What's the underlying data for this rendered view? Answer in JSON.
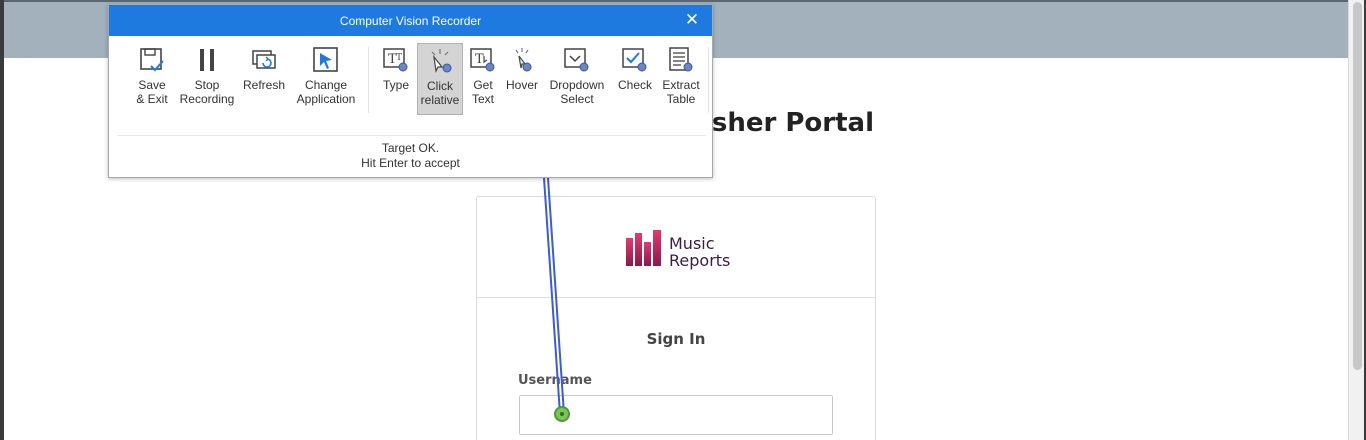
{
  "portal": {
    "title": "blisher Portal",
    "logo_line1": "Music",
    "logo_line2": "Reports",
    "signin_title": "Sign In",
    "username_label": "Username",
    "username_value": ""
  },
  "recorder": {
    "window_title": "Computer Vision Recorder",
    "close_icon": "close-icon",
    "tools": [
      {
        "id": "save-exit",
        "label1": "Save",
        "label2": "& Exit",
        "icon": "save-icon"
      },
      {
        "id": "stop-recording",
        "label1": "Stop",
        "label2": "Recording",
        "icon": "pause-icon"
      },
      {
        "id": "refresh",
        "label1": "Refresh",
        "label2": "",
        "icon": "refresh-icon"
      },
      {
        "id": "change-application",
        "label1": "Change",
        "label2": "Application",
        "icon": "cursor-window-icon"
      },
      {
        "id": "type",
        "label1": "Type",
        "label2": "",
        "icon": "type-icon"
      },
      {
        "id": "click-relative",
        "label1": "Click",
        "label2": "relative",
        "icon": "click-relative-icon",
        "active": true
      },
      {
        "id": "get-text",
        "label1": "Get",
        "label2": "Text",
        "icon": "get-text-icon"
      },
      {
        "id": "hover",
        "label1": "Hover",
        "label2": "",
        "icon": "hover-icon"
      },
      {
        "id": "dropdown-select",
        "label1": "Dropdown",
        "label2": "Select",
        "icon": "dropdown-icon"
      },
      {
        "id": "check",
        "label1": "Check",
        "label2": "",
        "icon": "check-icon"
      },
      {
        "id": "extract-table",
        "label1": "Extract",
        "label2": "Table",
        "icon": "table-icon"
      }
    ],
    "status_line1": "Target OK.",
    "status_line2": "Hit Enter to accept"
  },
  "colors": {
    "titlebar": "#1f7ae0",
    "header_band": "#a2b1bb",
    "target_line": "#3b5bdb",
    "target_dot": "#6abf4b",
    "logo_pink": "#c2185b",
    "logo_text": "#3a1c4a"
  }
}
